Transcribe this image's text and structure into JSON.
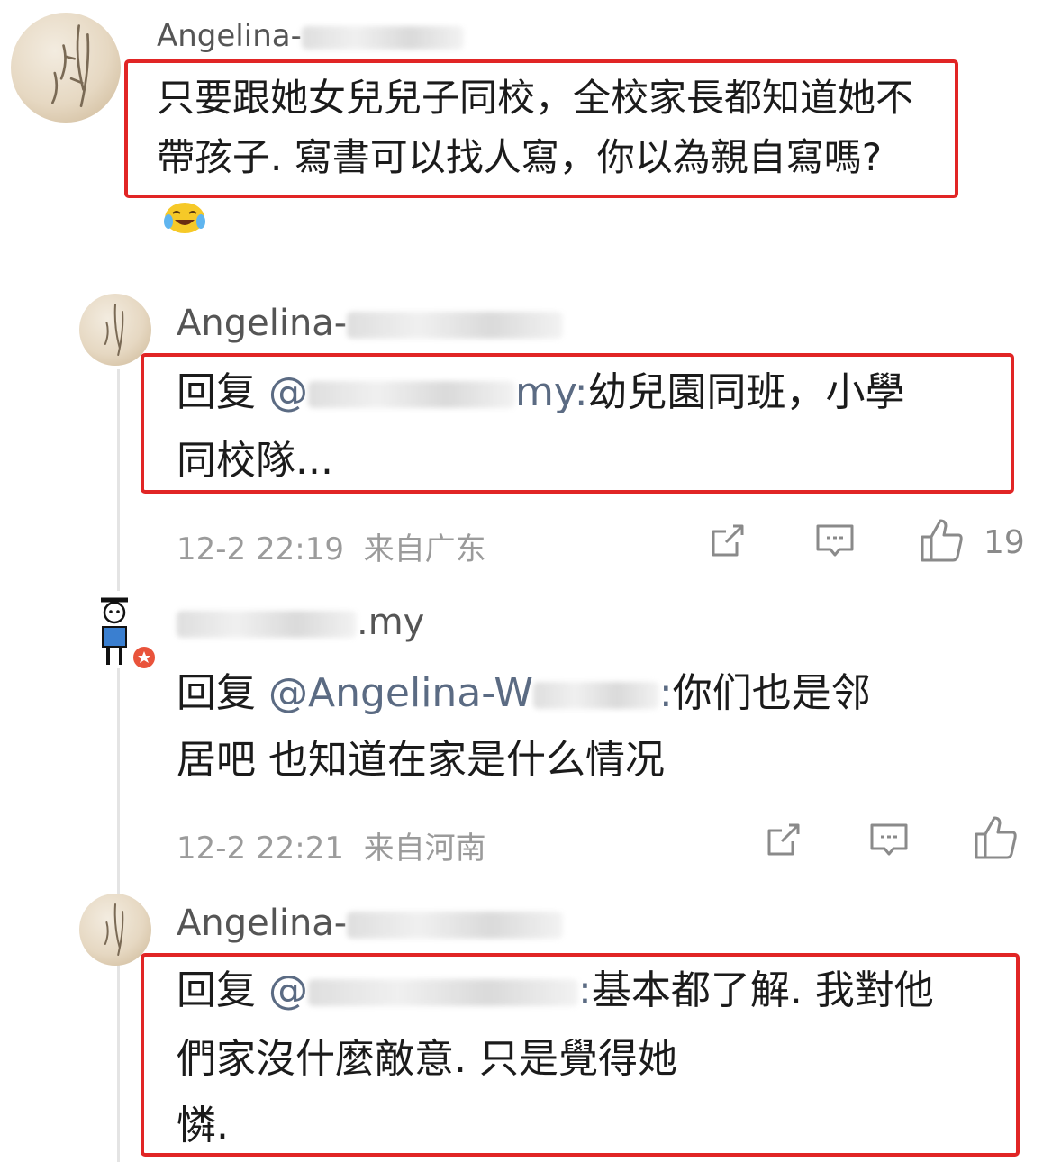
{
  "colors": {
    "highlight_box": "#e12525",
    "meta_text": "#9b9b9b",
    "username": "#555555",
    "mention": "#5b6b83"
  },
  "comments": [
    {
      "username": "Angelina-",
      "text_line1": "只要跟她女兒兒子同校，全校家長都知道她不",
      "text_line2": "帶孩子. 寫書可以找人寫，你以為親自寫嗎?",
      "emoji": "laughing-crying-emoji"
    },
    {
      "username": "Angelina-",
      "reply_prefix": "回复",
      "mention": "@",
      "mention_tail": "my:",
      "text_line1": "幼兒園同班，小學",
      "text_line2": "同校隊...",
      "date": "12-2 22:19",
      "location": "来自广东",
      "likes": "19"
    },
    {
      "username": ".my",
      "reply_prefix": "回复",
      "mention": "@Angelina-W",
      "mention_tail": ":",
      "text_line1": "你们也是邻",
      "text_line2": "居吧 也知道在家是什么情况",
      "date": "12-2 22:21",
      "location": "来自河南"
    },
    {
      "username": "Angelina-",
      "reply_prefix": "回复",
      "mention": "@",
      "mention_tail": ":",
      "text_line1": "基本都了解. 我對他",
      "text_line2": "們家沒什麼敵意. 只是覺得她",
      "text_line3": "憐."
    }
  ],
  "icons": [
    "share-icon",
    "comment-icon",
    "like-icon"
  ]
}
